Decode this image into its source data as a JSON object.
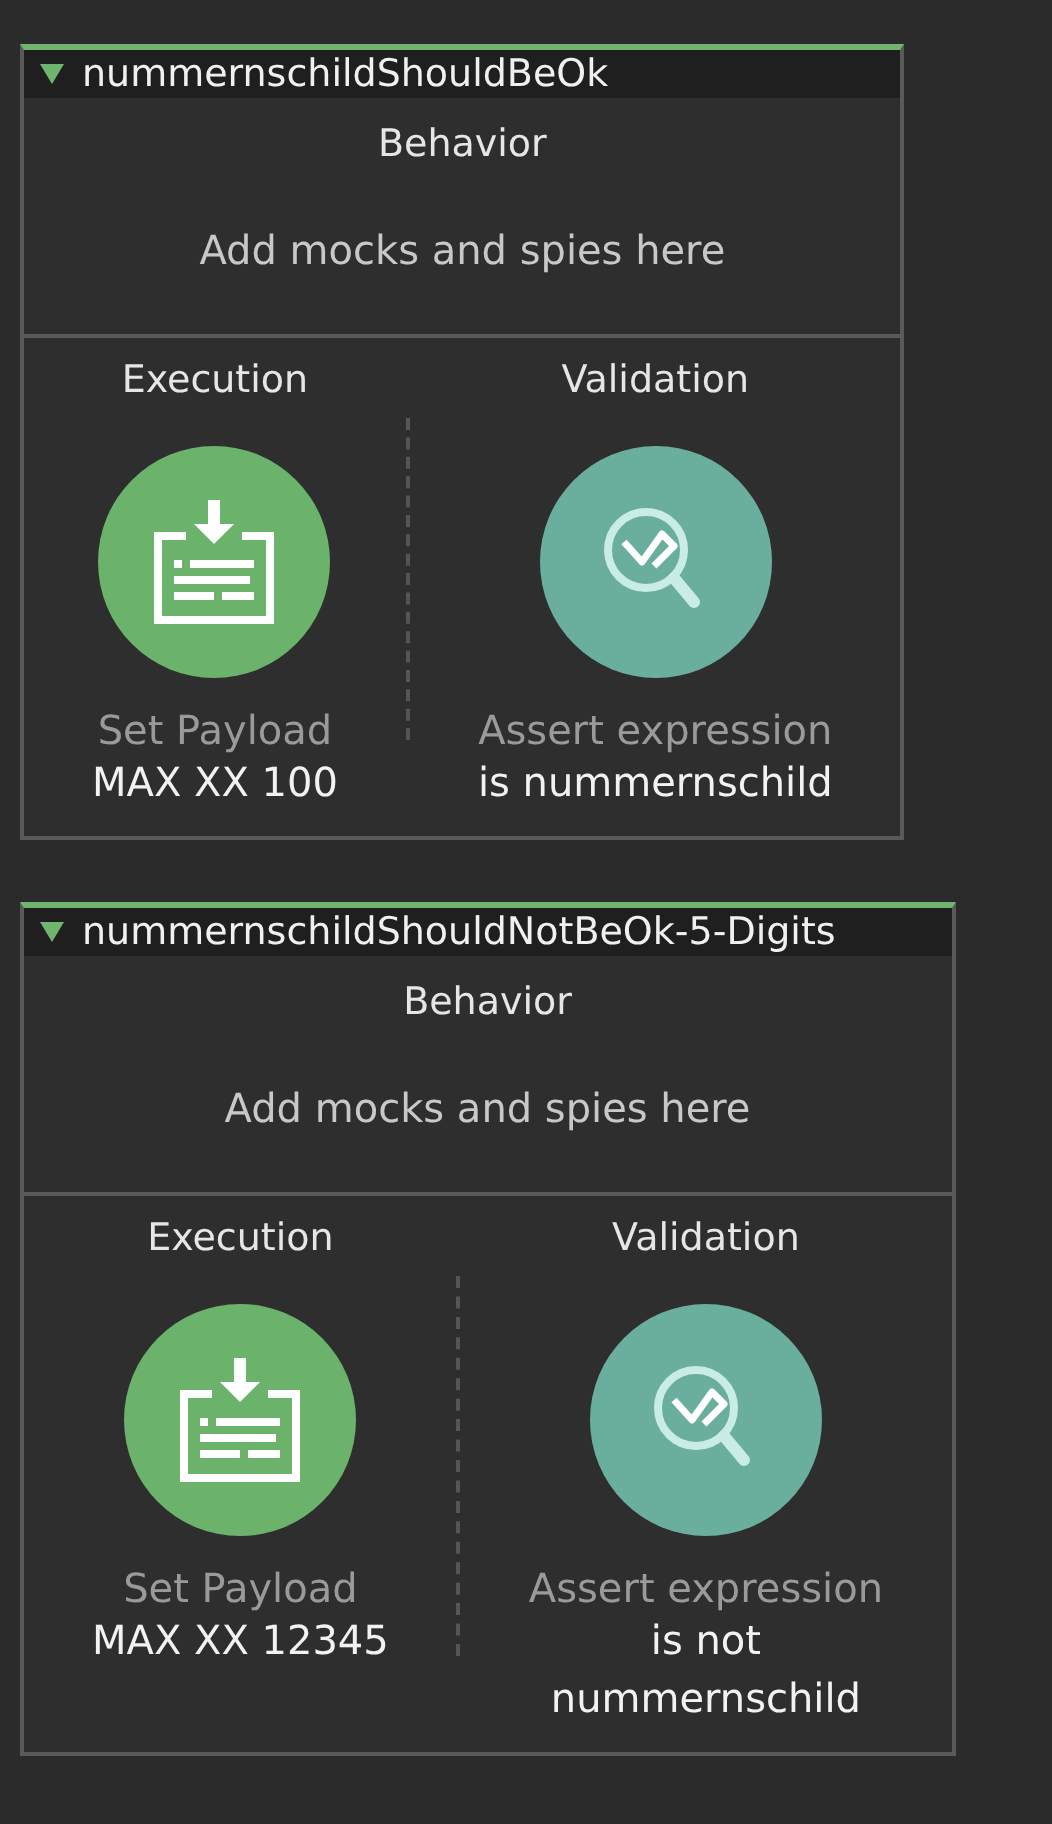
{
  "tests": [
    {
      "name": "nummernschildShouldBeOk",
      "expanded": true,
      "behavior": {
        "title": "Behavior",
        "empty_text": "Add mocks and spies here"
      },
      "execution": {
        "title": "Execution",
        "action": "Set Payload",
        "detail_lines": [
          "MAX XX 100"
        ]
      },
      "validation": {
        "title": "Validation",
        "action": "Assert expression",
        "detail_lines": [
          "is nummernschild"
        ]
      }
    },
    {
      "name": "nummernschildShouldNotBeOk-5-Digits",
      "expanded": true,
      "behavior": {
        "title": "Behavior",
        "empty_text": "Add mocks and spies here"
      },
      "execution": {
        "title": "Execution",
        "action": "Set Payload",
        "detail_lines": [
          "MAX XX 12345"
        ]
      },
      "validation": {
        "title": "Validation",
        "action": "Assert expression",
        "detail_lines": [
          "is not",
          "nummernschild"
        ]
      }
    }
  ]
}
